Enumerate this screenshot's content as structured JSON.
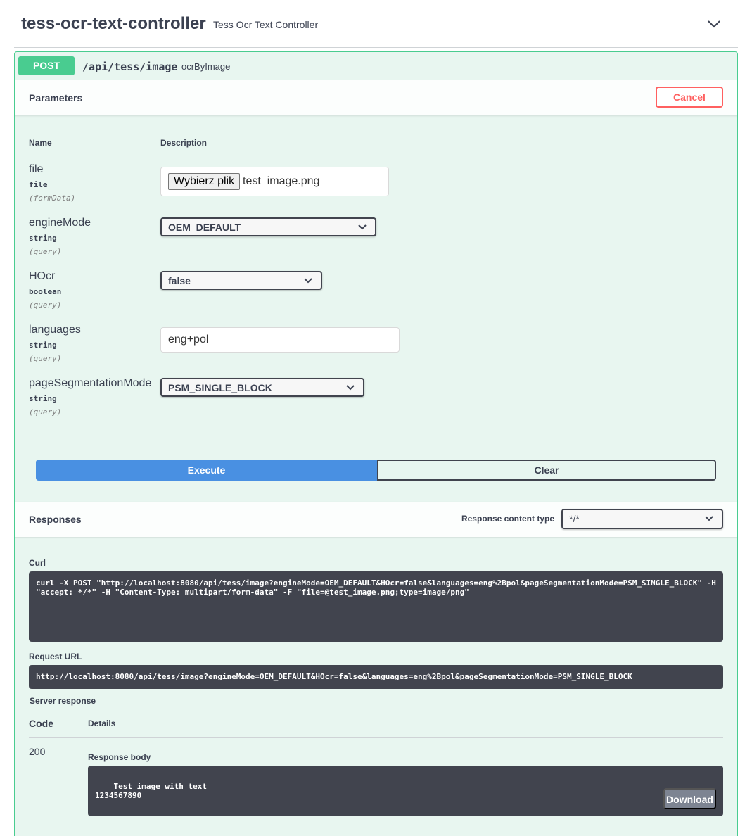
{
  "tag": {
    "title": "tess-ocr-text-controller",
    "description": "Tess Ocr Text Controller"
  },
  "operation": {
    "method": "POST",
    "path": "/api/tess/image",
    "summary": "ocrByImage",
    "method_color": "#49cc90"
  },
  "parameters": {
    "title": "Parameters",
    "cancel_label": "Cancel",
    "col_name": "Name",
    "col_description": "Description",
    "items": [
      {
        "name": "file",
        "type": "file",
        "in": "(formData)",
        "button_label": "Wybierz plik",
        "value": "test_image.png"
      },
      {
        "name": "engineMode",
        "type": "string",
        "in": "(query)",
        "value": "OEM_DEFAULT"
      },
      {
        "name": "HOcr",
        "type": "boolean",
        "in": "(query)",
        "value": "false"
      },
      {
        "name": "languages",
        "type": "string",
        "in": "(query)",
        "value": "eng+pol"
      },
      {
        "name": "pageSegmentationMode",
        "type": "string",
        "in": "(query)",
        "value": "PSM_SINGLE_BLOCK"
      }
    ]
  },
  "actions": {
    "execute_label": "Execute",
    "clear_label": "Clear",
    "execute_color": "#4990e2"
  },
  "responses": {
    "title": "Responses",
    "content_type_label": "Response content type",
    "content_type_value": "*/*",
    "curl_label": "Curl",
    "curl": "curl -X POST \"http://localhost:8080/api/tess/image?engineMode=OEM_DEFAULT&HOcr=false&languages=eng%2Bpol&pageSegmentationMode=PSM_SINGLE_BLOCK\" -H \"accept: */*\" -H \"Content-Type: multipart/form-data\" -F \"file=@test_image.png;type=image/png\"",
    "request_url_label": "Request URL",
    "request_url": "http://localhost:8080/api/tess/image?engineMode=OEM_DEFAULT&HOcr=false&languages=eng%2Bpol&pageSegmentationMode=PSM_SINGLE_BLOCK",
    "server_response_label": "Server response",
    "col_code": "Code",
    "col_details": "Details",
    "code": "200",
    "body_label": "Response body",
    "body": "Test image with text\n1234567890",
    "download_label": "Download"
  }
}
